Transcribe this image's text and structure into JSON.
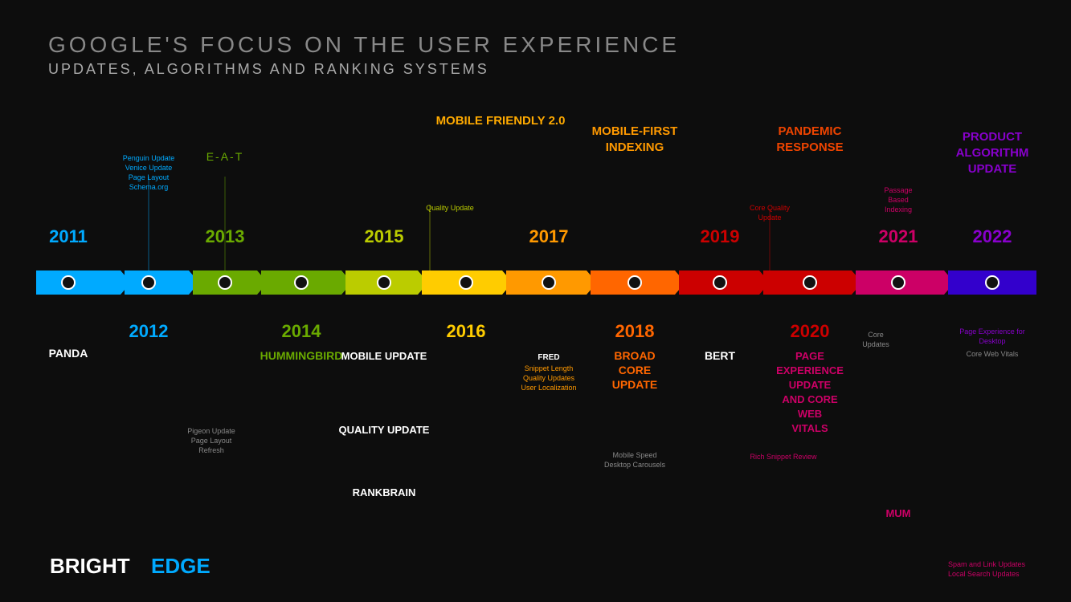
{
  "page": {
    "title": "GOOGLE'S FOCUS ON THE USER EXPERIENCE",
    "subtitle": "UPDATES, ALGORITHMS AND RANKING SYSTEMS"
  },
  "logo": {
    "bright": "BRIGHT",
    "edge": "EDGE"
  },
  "timeline": {
    "segments": [
      {
        "id": "2011",
        "color": "#00aaff",
        "year_above": "2011",
        "year_below": null,
        "text_above": null,
        "text_below": "PANDA",
        "text_above_small": null,
        "text_below_small": null
      },
      {
        "id": "2012",
        "color": "#00aaff",
        "year_above": null,
        "year_below": "2012",
        "text_above": "Penguin Update\nVenice Update\nPage Layout\nSchema.org",
        "text_below": null,
        "color_above": "#00aaff"
      },
      {
        "id": "2013",
        "color": "#6aaa00",
        "year_above": "2013",
        "year_below": null,
        "text_above": "E-A-T",
        "text_below": null,
        "color_above": "#6aaa00"
      },
      {
        "id": "2014",
        "color": "#6aaa00",
        "year_above": null,
        "year_below": "2014",
        "text_above": null,
        "text_below": "HUMMINGBIRD",
        "text_below_small": "Pigeon Update\nPage Layout\nRefresh",
        "color_below": "#6aaa00"
      },
      {
        "id": "2015",
        "color": "#cccc00",
        "year_above": "2015",
        "year_below": null,
        "text_above": "MOBILE FRIENDLY 2.0\nQuality Update",
        "text_below": "MOBILE UPDATE\nQUALITY UPDATE\nRANKBRAIN",
        "color_above": "#ffaa00",
        "color_below": "#cccc00"
      },
      {
        "id": "2016",
        "color": "#ffaa00",
        "year_above": null,
        "year_below": "2016",
        "text_above": null,
        "text_below": null
      },
      {
        "id": "2017",
        "color": "#ff8800",
        "year_above": "2017",
        "year_below": null,
        "text_above": "MOBILE-FIRST\nINDEXING",
        "text_below": "FRED\nSnippet Length\nQuality Updates\nUser Localization",
        "color_above": "#ff8800"
      },
      {
        "id": "2018",
        "color": "#ff6600",
        "year_above": null,
        "year_below": "2018",
        "text_above": null,
        "text_below": "BROAD\nCORE\nUPDATE",
        "text_below_small": "Mobile Speed\nDesktop Carousels",
        "color_below": "#ff6600"
      },
      {
        "id": "2019",
        "color": "#dd0000",
        "year_above": "2019",
        "year_below": null,
        "text_above": "PANDEMIC\nRESPONSE\nCore Quality\nUpdate",
        "text_below": "BERT",
        "text_below_small": "Rich Snippet Review",
        "color_above": "#ee4400"
      },
      {
        "id": "2020",
        "color": "#dd0000",
        "year_above": null,
        "year_below": "2020",
        "text_above": null,
        "text_below": "PAGE\nEXPERIENCE\nUPDATE\nAND CORE\nWEB\nVITALS"
      },
      {
        "id": "2021",
        "color": "#cc0066",
        "year_above": "2021",
        "year_below": null,
        "text_above": "Passage\nBased\nIndexing\nCore\nUpdates",
        "text_below": "MUM",
        "color_above": "#cc0066"
      },
      {
        "id": "2022",
        "color": "#6600aa",
        "year_above": "2022",
        "year_below": null,
        "text_above": "PRODUCT\nALGORITHM\nUPDATE",
        "text_below_small": "Page Experience for\nDesktop\nCore Web Vitals\nSpam and Link Updates\nLocal Search Updates",
        "color_above": "#8800cc"
      }
    ]
  }
}
